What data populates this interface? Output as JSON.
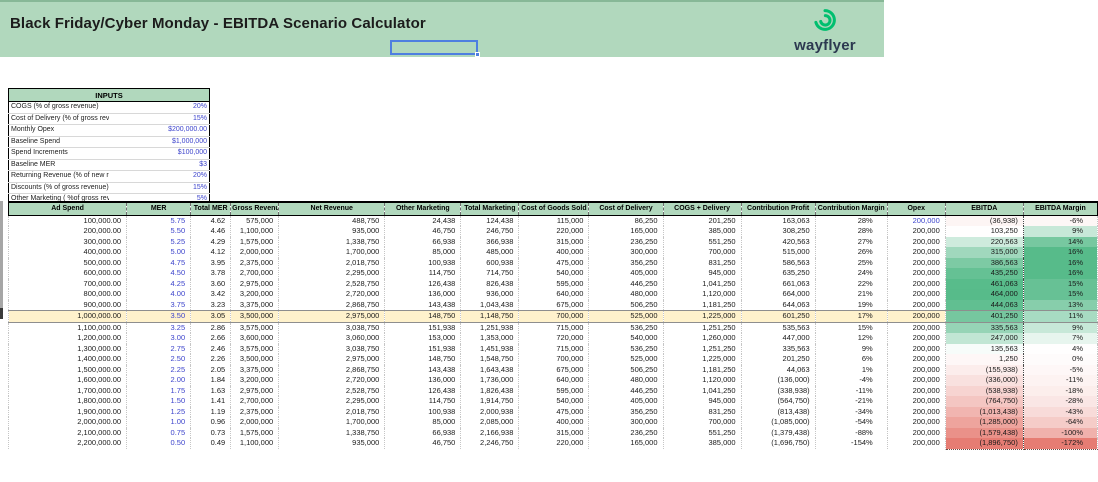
{
  "banner": {
    "title": "Black Friday/Cyber Monday - EBITDA Scenario Calculator",
    "logo_text": "wayflyer"
  },
  "colors": {
    "header_green": "#b1d8bd",
    "input_value_blue": "#3d44cc",
    "highlight_yellow": "#fff2cc",
    "selection_blue": "#4e7fe0",
    "logo_green": "#00bf6f",
    "logo_text_navy": "#2c3950",
    "scale_min_red": "#e67c73",
    "scale_mid_white": "#ffffff",
    "scale_max_green": "#57bb8a"
  },
  "inputs": {
    "title": "INPUTS",
    "rows": [
      {
        "label": "COGS (% of gross revenue)",
        "value": "20%"
      },
      {
        "label": "Cost of Delivery (% of gross revenue",
        "value": "15%"
      },
      {
        "label": "Monthly Opex",
        "value": "$200,000.00"
      },
      {
        "label": "Baseline Spend",
        "value": "$1,000,000"
      },
      {
        "label": "Spend Increments",
        "value": "$100,000"
      },
      {
        "label": "Baseline MER",
        "value": "$3"
      },
      {
        "label": "Returning Revenue (% of new revenue)",
        "value": "20%"
      },
      {
        "label": "Discounts (% of gross revenue)",
        "value": "15%"
      },
      {
        "label": "Other Marketing ( %of gross revenue)",
        "value": "5%"
      }
    ]
  },
  "table": {
    "columns": [
      "Ad Spend",
      "MER",
      "Total MER",
      "Gross Revenue",
      "Net Revenue",
      "Other Marketing",
      "Total Marketing",
      "Cost of Goods Sold",
      "Cost of Delivery",
      "COGS + Delivery",
      "Contribution Profit",
      "Contribution Margin",
      "Opex",
      "EBITDA",
      "EBITDA Margin"
    ],
    "highlighted_row_index": 9,
    "rows": [
      [
        "100,000.00",
        "5.75",
        "4.62",
        "575,000",
        "488,750",
        "24,438",
        "124,438",
        "115,000",
        "86,250",
        "201,250",
        "163,063",
        "28%",
        "200,000",
        "(36,938)",
        "-6%"
      ],
      [
        "200,000.00",
        "5.50",
        "4.46",
        "1,100,000",
        "935,000",
        "46,750",
        "246,750",
        "220,000",
        "165,000",
        "385,000",
        "308,250",
        "28%",
        "200,000",
        "103,250",
        "9%"
      ],
      [
        "300,000.00",
        "5.25",
        "4.29",
        "1,575,000",
        "1,338,750",
        "66,938",
        "366,938",
        "315,000",
        "236,250",
        "551,250",
        "420,563",
        "27%",
        "200,000",
        "220,563",
        "14%"
      ],
      [
        "400,000.00",
        "5.00",
        "4.12",
        "2,000,000",
        "1,700,000",
        "85,000",
        "485,000",
        "400,000",
        "300,000",
        "700,000",
        "515,000",
        "26%",
        "200,000",
        "315,000",
        "16%"
      ],
      [
        "500,000.00",
        "4.75",
        "3.95",
        "2,375,000",
        "2,018,750",
        "100,938",
        "600,938",
        "475,000",
        "356,250",
        "831,250",
        "586,563",
        "25%",
        "200,000",
        "386,563",
        "16%"
      ],
      [
        "600,000.00",
        "4.50",
        "3.78",
        "2,700,000",
        "2,295,000",
        "114,750",
        "714,750",
        "540,000",
        "405,000",
        "945,000",
        "635,250",
        "24%",
        "200,000",
        "435,250",
        "16%"
      ],
      [
        "700,000.00",
        "4.25",
        "3.60",
        "2,975,000",
        "2,528,750",
        "126,438",
        "826,438",
        "595,000",
        "446,250",
        "1,041,250",
        "661,063",
        "22%",
        "200,000",
        "461,063",
        "15%"
      ],
      [
        "800,000.00",
        "4.00",
        "3.42",
        "3,200,000",
        "2,720,000",
        "136,000",
        "936,000",
        "640,000",
        "480,000",
        "1,120,000",
        "664,000",
        "21%",
        "200,000",
        "464,000",
        "15%"
      ],
      [
        "900,000.00",
        "3.75",
        "3.23",
        "3,375,000",
        "2,868,750",
        "143,438",
        "1,043,438",
        "675,000",
        "506,250",
        "1,181,250",
        "644,063",
        "19%",
        "200,000",
        "444,063",
        "13%"
      ],
      [
        "1,000,000.00",
        "3.50",
        "3.05",
        "3,500,000",
        "2,975,000",
        "148,750",
        "1,148,750",
        "700,000",
        "525,000",
        "1,225,000",
        "601,250",
        "17%",
        "200,000",
        "401,250",
        "11%"
      ],
      [
        "1,100,000.00",
        "3.25",
        "2.86",
        "3,575,000",
        "3,038,750",
        "151,938",
        "1,251,938",
        "715,000",
        "536,250",
        "1,251,250",
        "535,563",
        "15%",
        "200,000",
        "335,563",
        "9%"
      ],
      [
        "1,200,000.00",
        "3.00",
        "2.66",
        "3,600,000",
        "3,060,000",
        "153,000",
        "1,353,000",
        "720,000",
        "540,000",
        "1,260,000",
        "447,000",
        "12%",
        "200,000",
        "247,000",
        "7%"
      ],
      [
        "1,300,000.00",
        "2.75",
        "2.46",
        "3,575,000",
        "3,038,750",
        "151,938",
        "1,451,938",
        "715,000",
        "536,250",
        "1,251,250",
        "335,563",
        "9%",
        "200,000",
        "135,563",
        "4%"
      ],
      [
        "1,400,000.00",
        "2.50",
        "2.26",
        "3,500,000",
        "2,975,000",
        "148,750",
        "1,548,750",
        "700,000",
        "525,000",
        "1,225,000",
        "201,250",
        "6%",
        "200,000",
        "1,250",
        "0%"
      ],
      [
        "1,500,000.00",
        "2.25",
        "2.05",
        "3,375,000",
        "2,868,750",
        "143,438",
        "1,643,438",
        "675,000",
        "506,250",
        "1,181,250",
        "44,063",
        "1%",
        "200,000",
        "(155,938)",
        "-5%"
      ],
      [
        "1,600,000.00",
        "2.00",
        "1.84",
        "3,200,000",
        "2,720,000",
        "136,000",
        "1,736,000",
        "640,000",
        "480,000",
        "1,120,000",
        "(136,000)",
        "-4%",
        "200,000",
        "(336,000)",
        "-11%"
      ],
      [
        "1,700,000.00",
        "1.75",
        "1.63",
        "2,975,000",
        "2,528,750",
        "126,438",
        "1,826,438",
        "595,000",
        "446,250",
        "1,041,250",
        "(338,938)",
        "-11%",
        "200,000",
        "(538,938)",
        "-18%"
      ],
      [
        "1,800,000.00",
        "1.50",
        "1.41",
        "2,700,000",
        "2,295,000",
        "114,750",
        "1,914,750",
        "540,000",
        "405,000",
        "945,000",
        "(564,750)",
        "-21%",
        "200,000",
        "(764,750)",
        "-28%"
      ],
      [
        "1,900,000.00",
        "1.25",
        "1.19",
        "2,375,000",
        "2,018,750",
        "100,938",
        "2,000,938",
        "475,000",
        "356,250",
        "831,250",
        "(813,438)",
        "-34%",
        "200,000",
        "(1,013,438)",
        "-43%"
      ],
      [
        "2,000,000.00",
        "1.00",
        "0.96",
        "2,000,000",
        "1,700,000",
        "85,000",
        "2,085,000",
        "400,000",
        "300,000",
        "700,000",
        "(1,085,000)",
        "-54%",
        "200,000",
        "(1,285,000)",
        "-64%"
      ],
      [
        "2,100,000.00",
        "0.75",
        "0.73",
        "1,575,000",
        "1,338,750",
        "66,938",
        "2,166,938",
        "315,000",
        "236,250",
        "551,250",
        "(1,379,438)",
        "-88%",
        "200,000",
        "(1,579,438)",
        "-100%"
      ],
      [
        "2,200,000.00",
        "0.50",
        "0.49",
        "1,100,000",
        "935,000",
        "46,750",
        "2,246,750",
        "220,000",
        "165,000",
        "385,000",
        "(1,696,750)",
        "-154%",
        "200,000",
        "(1,896,750)",
        "-172%"
      ]
    ]
  }
}
